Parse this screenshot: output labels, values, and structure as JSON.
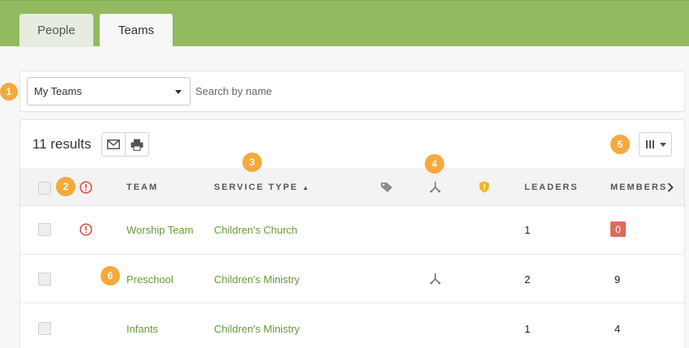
{
  "tabs": [
    {
      "label": "People",
      "active": false
    },
    {
      "label": "Teams",
      "active": true
    }
  ],
  "filter": {
    "select_value": "My Teams",
    "search_placeholder": "Search by name"
  },
  "results": {
    "count_label": "11 results"
  },
  "table": {
    "columns": {
      "team": "TEAM",
      "service_type": "SERVICE TYPE",
      "service_type_sort": "▲",
      "leaders": "LEADERS",
      "members": "MEMBERS"
    },
    "rows": [
      {
        "alert": true,
        "team": "Worship Team",
        "service_type": "Children's Church",
        "split": false,
        "leaders": "1",
        "members": "0",
        "members_highlight": true
      },
      {
        "alert": false,
        "team": "Preschool",
        "service_type": "Children's Ministry",
        "split": true,
        "leaders": "2",
        "members": "9",
        "members_highlight": false
      },
      {
        "alert": false,
        "team": "Infants",
        "service_type": "Children's Ministry",
        "split": false,
        "leaders": "1",
        "members": "4",
        "members_highlight": false
      }
    ]
  },
  "callouts": [
    "1",
    "2",
    "3",
    "4",
    "5",
    "6"
  ],
  "icons": {
    "mail": "mail-icon",
    "print": "print-icon",
    "columns": "columns-icon",
    "alert": "alert-circle-icon",
    "tag": "tag-icon",
    "split": "split-icon",
    "shield": "shield-icon",
    "chevron": "chevron-right-icon"
  },
  "colors": {
    "brand_green": "#91bb5e",
    "link_green": "#6a9a3a",
    "alert_red": "#e34b3b",
    "callout_orange": "#f6a93b",
    "shield_yellow": "#f3b521",
    "badge_red": "#e06b5b"
  }
}
